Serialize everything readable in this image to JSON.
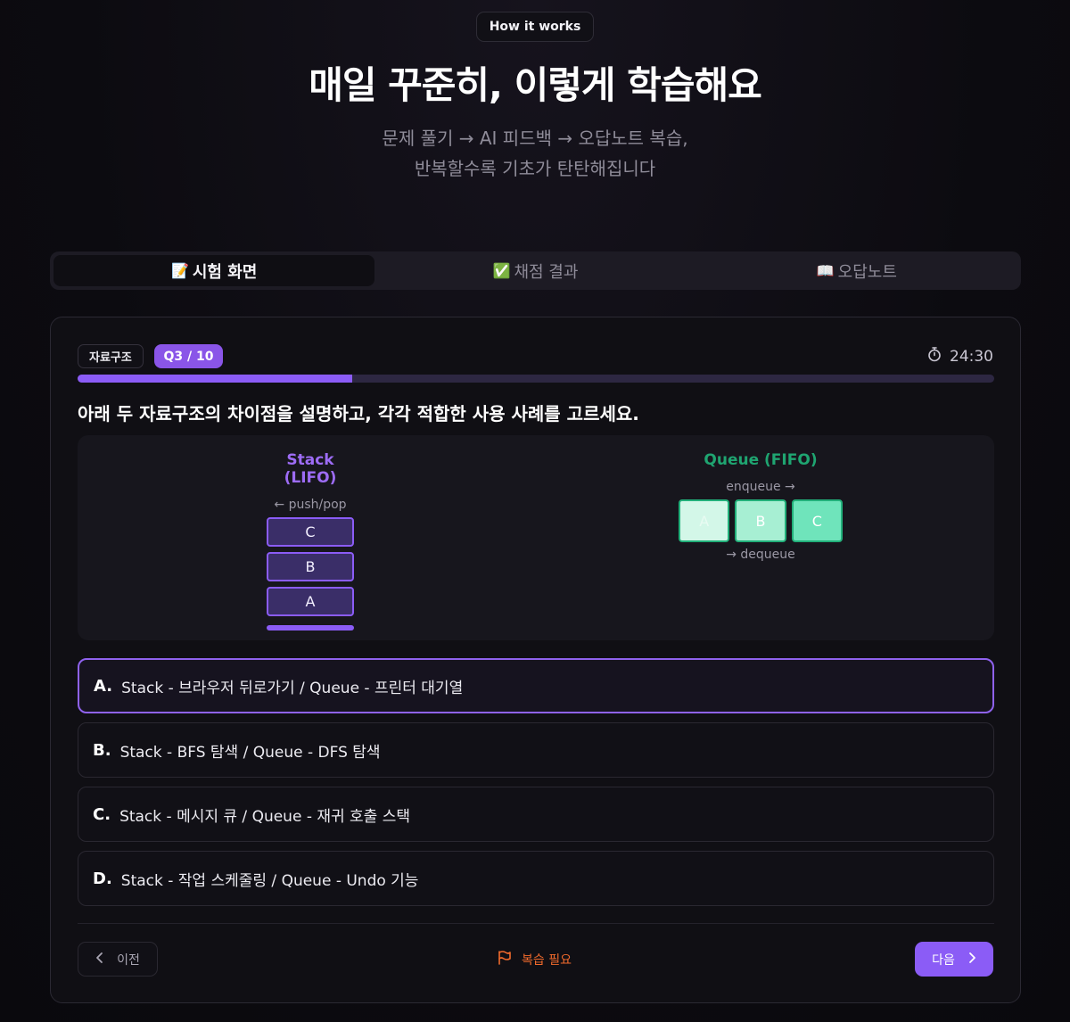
{
  "header": {
    "badge": "How it works",
    "title": "매일 꾸준히, 이렇게 학습해요",
    "subtitle_line1": "문제 풀기 → AI 피드백 → 오답노트 복습,",
    "subtitle_line2": "반복할수록 기초가 탄탄해집니다"
  },
  "tabs": [
    {
      "emoji": "📝",
      "label": "시험 화면",
      "active": true
    },
    {
      "emoji": "✅",
      "label": "채점 결과",
      "active": false
    },
    {
      "emoji": "📖",
      "label": "오답노트",
      "active": false
    }
  ],
  "quiz": {
    "category": "자료구조",
    "question_counter": "Q3 / 10",
    "timer": "24:30",
    "progress": 0.3,
    "question": "아래 두 자료구조의 차이점을 설명하고, 각각 적합한 사용 사례를 고르세요.",
    "diagram": {
      "stack_title": "Stack (LIFO)",
      "stack_hint": "← push/pop",
      "stack_items": [
        "C",
        "B",
        "A"
      ],
      "queue_title": "Queue (FIFO)",
      "queue_hint_in": "enqueue →",
      "queue_items": [
        "A",
        "B",
        "C"
      ],
      "queue_hint_out": "→ dequeue"
    },
    "options": [
      {
        "letter": "A.",
        "text": "Stack - 브라우저 뒤로가기 / Queue - 프린터 대기열",
        "selected": true
      },
      {
        "letter": "B.",
        "text": "Stack - BFS 탐색 / Queue - DFS 탐색",
        "selected": false
      },
      {
        "letter": "C.",
        "text": "Stack - 메시지 큐 / Queue - 재귀 호출 스택",
        "selected": false
      },
      {
        "letter": "D.",
        "text": "Stack - 작업 스케줄링 / Queue - Undo 기능",
        "selected": false
      }
    ],
    "prev_label": "이전",
    "review_label": "복습 필요",
    "next_label": "다음"
  },
  "colors": {
    "accent": "#8b5cf6",
    "queue_green": "#22b07a",
    "review_orange": "#f06a2c"
  }
}
